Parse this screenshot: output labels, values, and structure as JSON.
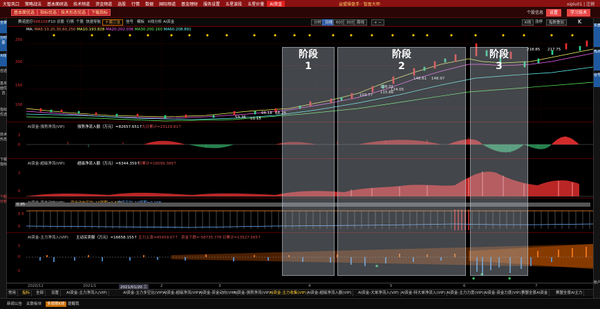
{
  "menubar": {
    "items": [
      "大智风口",
      "策略战法",
      "基本面研选",
      "技术频道",
      "资金频道",
      "选股",
      "行情",
      "数据",
      "国际频道",
      "基金理财",
      "服务设置",
      "五星波段",
      "五星价量",
      "AI资金"
    ],
    "active_index": 13,
    "title": "益盟操盘手 · 智盈大师",
    "right": "xiplu01 | 注销"
  },
  "subtabs": {
    "left": [
      "基本面优选",
      "指标优选",
      "技术形态优选",
      "下载指标"
    ],
    "right": [
      "个股信息",
      "设置",
      "学习技术"
    ]
  },
  "left_sidebar": [
    "全景",
    "分时图",
    "K线",
    "自选",
    "基本面优选",
    "指标优选",
    "技术形态",
    "下载指标",
    "个股分析"
  ],
  "right_sidebar": [
    "实盘",
    "热点",
    "信号",
    "账户"
  ],
  "toolbar": {
    "stock_name": "赛诺医疗",
    "code": "688108",
    "items": [
      "F10",
      "诊股",
      "行情",
      "个股",
      "快速导航",
      "信号",
      "模板",
      "K线分析",
      "AI资金"
    ],
    "active": "十周三法",
    "periods": [
      "分时",
      "日线",
      "60分",
      "30分",
      "周线"
    ],
    "active_period": "日线",
    "right": [
      "K线",
      "涨停",
      "指数叠加",
      "K"
    ]
  },
  "ma_line": {
    "prefix": "MA: ",
    "values": [
      "MA5:10.20,30,60,250",
      "MA10:193.828",
      "MA20:202.036",
      "MA30:200.160",
      "MA60:208.891"
    ]
  },
  "main_chart": {
    "ylabels": [
      "250",
      "200",
      "150",
      "100"
    ],
    "annotations": [
      "218.85",
      "217.75",
      "146.61",
      "148.97",
      "108.01",
      "103.77",
      "124.05",
      "115.86",
      "66.18",
      "68.28",
      "59.36",
      "51.15"
    ]
  },
  "stages": [
    {
      "label_top": "阶段",
      "label_num": "1"
    },
    {
      "label_top": "阶段",
      "label_num": "2"
    },
    {
      "label_top": "阶段",
      "label_num": "3"
    }
  ],
  "panel1": {
    "title": "AI资金-强势净流(VIP)",
    "legend": [
      "强势净流入额（万元）=82657.651↑",
      "大日累计=23129.81↑"
    ],
    "ylabels": [
      "2",
      "0"
    ]
  },
  "panel2": {
    "title": "AI资金-超级净流(VIP)",
    "legend": [
      "超级净流入额（万元）=6344.359↑",
      "日累计=16099.389↑"
    ],
    "ylabels": [
      "2",
      "0"
    ]
  },
  "panel3": {
    "title": "AI资金-资金动向(VIP)",
    "legend": [
      "资金动向平均_10周期=0.602",
      "游资平均_10周期=0.198"
    ],
    "ylabels": [
      "0.95",
      "0.5",
      "0"
    ]
  },
  "panel4": {
    "title": "AI资金-主力净流入(VIP)",
    "legend": [
      "主动买卖额（万元）=16658.155↑",
      "主力上涨=45459.07↑",
      "资金下跌=-58735.778",
      "日累计=13527.565↑"
    ],
    "ylabels": [
      "1",
      "0",
      "-1"
    ]
  },
  "xaxis": {
    "labels": [
      "2020/12",
      "2021/1",
      "2021/01/20 三",
      "2",
      "3",
      "4",
      "5",
      "6",
      "7"
    ]
  },
  "bottom_tabs": [
    "常用",
    "指标",
    "全部",
    "设置",
    "AI资金-主力净流入(VIP)",
    "AI资金-主力多空比(VIP)",
    "AI资金-超级净流(VIP)",
    "AI资金-资金动向(VIP)",
    "AI资金-强势净流(VIP)",
    "AI资金-主力收集(VIP)",
    "AI资金-超级净流入额(VIP)",
    "AI资金-大单净流入(VIP)",
    "AI资金-特大单净流入(VIP)",
    "AI资金-主力力度(VIP)",
    "AI资金-资金力度(VIP)",
    "赛盟全景AI资金",
    "赛盟全景AI主力",
    "自定义"
  ],
  "bottom_tabs_selected": 9,
  "status_bar": [
    "新闻公告",
    "关联板块",
    "多周期K线",
    "提醒我"
  ],
  "status_highlight": 2,
  "colors": {
    "up": "#e83030",
    "down": "#2fd090",
    "accent": "#e02020",
    "gold": "#ffb040"
  }
}
